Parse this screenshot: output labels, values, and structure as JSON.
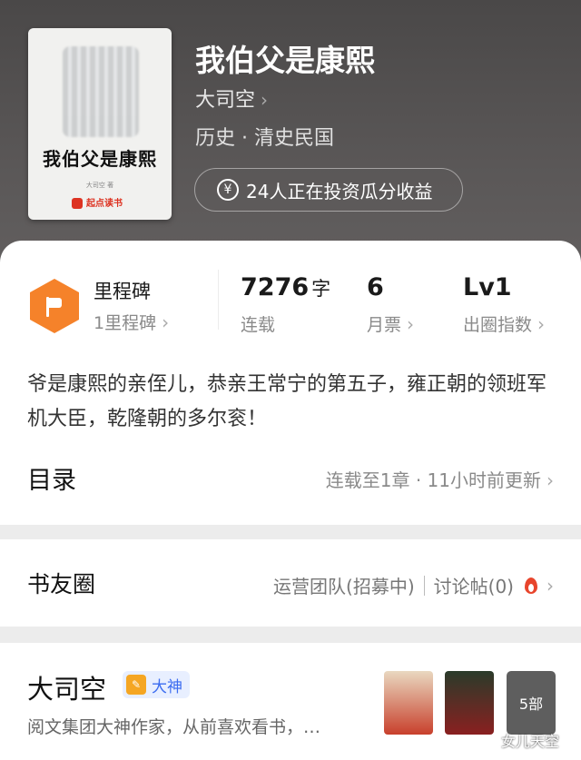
{
  "book": {
    "title": "我伯父是康熙",
    "author": "大司空",
    "category": "历史 · 清史民国",
    "invest_text": "24人正在投资瓜分收益",
    "cover_title": "我伯父是康熙",
    "cover_author": "大司空 著",
    "cover_brand": "起点读书"
  },
  "stats": {
    "milestone_label": "里程碑",
    "milestone_count": "1里程碑",
    "word_count": "7276",
    "word_unit": "字",
    "word_status": "连载",
    "monthly_tickets": "6",
    "monthly_label": "月票",
    "level": "Lv1",
    "level_label": "出圈指数"
  },
  "synopsis": "爷是康熙的亲侄儿，恭亲王常宁的第五子，雍正朝的领班军机大臣，乾隆朝的多尔衮！",
  "toc": {
    "title": "目录",
    "status": "连载至1章 · 11小时前更新"
  },
  "circle": {
    "title": "书友圈",
    "team": "运营团队(招募中)",
    "posts": "讨论帖(0)"
  },
  "author_card": {
    "name": "大司空",
    "badge": "大神",
    "desc": "阅文集团大神作家，从前喜欢看书，…",
    "works_count": "5部"
  },
  "watermark": "女儿天空",
  "icons": [
    "yen-icon",
    "flag-icon",
    "chevron-right-icon",
    "fire-icon",
    "pen-icon"
  ],
  "colors": {
    "accent_orange": "#f5822a",
    "badge_blue": "#3b6cf0",
    "fire_red": "#e8452c"
  }
}
